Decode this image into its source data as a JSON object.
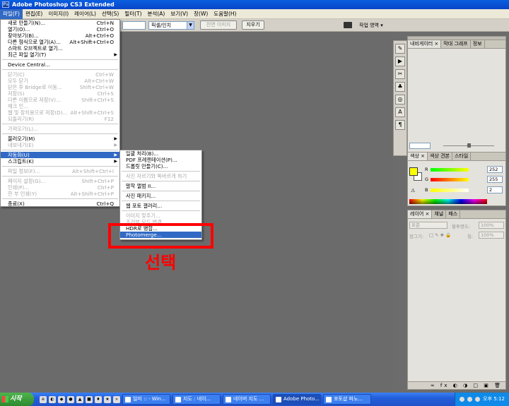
{
  "window": {
    "title": "Adobe Photoshop CS3 Extended"
  },
  "menubar": [
    "파일(F)",
    "편집(E)",
    "이미지(I)",
    "레이어(L)",
    "선택(S)",
    "필터(T)",
    "분석(A)",
    "보기(V)",
    "창(W)",
    "도움말(H)"
  ],
  "options_bar": {
    "resolution_unit": "픽셀/인치",
    "front_image_button": "전면 이미지",
    "clear_button": "지우기",
    "workspace_label": "작업 영역 ▾"
  },
  "file_menu": [
    {
      "label": "새로 만들기(N)...",
      "shortcut": "Ctrl+N",
      "enabled": true
    },
    {
      "label": "열기(O)...",
      "shortcut": "Ctrl+O",
      "enabled": true
    },
    {
      "label": "찾아보기(B)...",
      "shortcut": "Alt+Ctrl+O",
      "enabled": true
    },
    {
      "label": "다른 형식으로 열기(A)...",
      "shortcut": "Alt+Shift+Ctrl+O",
      "enabled": true
    },
    {
      "label": "스마트 오브젝트로 열기...",
      "shortcut": "",
      "enabled": true
    },
    {
      "label": "최근 파일 열기(T)",
      "shortcut": "",
      "enabled": true,
      "submenu": true
    },
    {
      "sep": true
    },
    {
      "label": "Device Central...",
      "shortcut": "",
      "enabled": true
    },
    {
      "sep": true
    },
    {
      "label": "닫기(C)",
      "shortcut": "Ctrl+W",
      "enabled": false
    },
    {
      "label": "모두 닫기",
      "shortcut": "Alt+Ctrl+W",
      "enabled": false
    },
    {
      "label": "닫은 후 Bridge로 이동...",
      "shortcut": "Shift+Ctrl+W",
      "enabled": false
    },
    {
      "label": "저장(S)",
      "shortcut": "Ctrl+S",
      "enabled": false
    },
    {
      "label": "다른 이름으로 저장(V)...",
      "shortcut": "Shift+Ctrl+S",
      "enabled": false
    },
    {
      "label": "체크 인...",
      "shortcut": "",
      "enabled": false
    },
    {
      "label": "웹 및 장치용으로 저장(D)...",
      "shortcut": "Alt+Shift+Ctrl+S",
      "enabled": false
    },
    {
      "label": "되돌리기(R)",
      "shortcut": "F12",
      "enabled": false
    },
    {
      "sep": true
    },
    {
      "label": "가져오기(L)...",
      "shortcut": "",
      "enabled": false
    },
    {
      "sep": true
    },
    {
      "label": "불러오기(M)",
      "shortcut": "",
      "enabled": true,
      "submenu": true
    },
    {
      "label": "내보내기(E)",
      "shortcut": "",
      "enabled": false,
      "submenu": true
    },
    {
      "sep": true
    },
    {
      "label": "자동화(U)",
      "shortcut": "",
      "enabled": true,
      "submenu": true,
      "highlighted": true
    },
    {
      "label": "스크립트(K)",
      "shortcut": "",
      "enabled": true,
      "submenu": true
    },
    {
      "sep": true
    },
    {
      "label": "파일 정보(F)...",
      "shortcut": "Alt+Shift+Ctrl+I",
      "enabled": false
    },
    {
      "sep": true
    },
    {
      "label": "페이지 설정(G)...",
      "shortcut": "Shift+Ctrl+P",
      "enabled": false
    },
    {
      "label": "인쇄(P)...",
      "shortcut": "Ctrl+P",
      "enabled": false
    },
    {
      "label": "한 부 인쇄(Y)",
      "shortcut": "Alt+Shift+Ctrl+P",
      "enabled": false
    },
    {
      "sep": true
    },
    {
      "label": "종료(X)",
      "shortcut": "Ctrl+Q",
      "enabled": true
    }
  ],
  "automate_menu": [
    {
      "label": "일괄 처리(B)...",
      "enabled": true
    },
    {
      "label": "PDF 프레젠테이션(P)...",
      "enabled": true
    },
    {
      "label": "드롭릿 만들기(C)...",
      "enabled": true
    },
    {
      "sep": true
    },
    {
      "label": "사진 자르기와 똑바르게 하기",
      "enabled": false
    },
    {
      "sep": true
    },
    {
      "label": "말착 앨범 II...",
      "enabled": true
    },
    {
      "sep": true
    },
    {
      "label": "사진 패키지...",
      "enabled": true
    },
    {
      "sep": true
    },
    {
      "label": "웹 포토 갤러리...",
      "enabled": true
    },
    {
      "sep": true
    },
    {
      "label": "이미지 맞추기...",
      "enabled": false
    },
    {
      "label": "조건부 모드 변경...",
      "enabled": false
    },
    {
      "label": "HDR로 병합...",
      "enabled": true
    },
    {
      "label": "Photomerge...",
      "enabled": true,
      "highlighted": true
    }
  ],
  "annotation": {
    "label": "선택",
    "color": "#ff0000"
  },
  "panels": {
    "navigator_tabs": [
      "내비게이터 ×",
      "막대 그래프",
      "정보"
    ],
    "color_tabs": [
      "색상 ×",
      "색상 견본",
      "스타일"
    ],
    "color": {
      "foreground": "#fcff00",
      "background": "#ffffff",
      "r_label": "R",
      "g_label": "G",
      "b_label": "B",
      "r": "252",
      "g": "255",
      "b": "2"
    },
    "layers_tabs": [
      "레이어 ×",
      "채널",
      "패스"
    ],
    "layers": {
      "blend_mode": "표준",
      "opacity_label": "불투명도:",
      "opacity": "100%",
      "lock_label": "잠그기:",
      "fill_label": "칠:",
      "fill": "100%"
    }
  },
  "taskbar": {
    "start_label": "시작",
    "buttons": [
      "일미 :: - Win...",
      "지도 : 네이...",
      "네이버 지도 ...",
      "Adobe Photo...",
      "포토샵 파노..."
    ],
    "active_index": 3,
    "clock": "오후 5:12"
  }
}
